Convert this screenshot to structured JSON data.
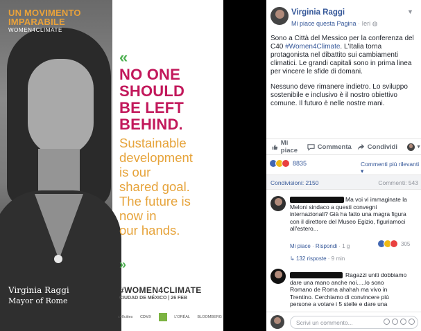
{
  "poster": {
    "brand_line1": "UN MOVIMENTO",
    "brand_line2": "IMPARABILE",
    "brand_sub": "WOMEN4CLIMATE",
    "quote_open": "«",
    "headline": [
      "NO ONE",
      "SHOULD",
      "BE LEFT",
      "BEHIND."
    ],
    "subline": [
      "Sustainable",
      "development",
      "is our",
      "shared goal.",
      "The future is",
      "now in",
      "our hands."
    ],
    "quote_close": "»",
    "speaker_name": "Virginia Raggi",
    "speaker_role": "Mayor of Rome",
    "hashtag": "#WOMEN4CLIMATE",
    "event": "CIUDAD DE MÉXICO | 26 FEB",
    "partners": [
      "c40cities",
      "CDMX",
      "",
      "L'ORÉAL",
      "BLOOMBERG"
    ]
  },
  "post": {
    "author": "Virginia Raggi",
    "like_page": "Mi piace questa Pagina",
    "time": "Ieri",
    "p1_a": "Sono a Città del Messico per la conferenza del C40 ",
    "p1_tag": "#Women4Climate",
    "p1_b": ". L'Italia torna protagonista nel dibattito sui cambiamenti climatici. Le grandi capitali sono in prima linea per vincere le sfide di domani.",
    "p2": "Nessuno deve rimanere indietro. Lo sviluppo sostenibile e inclusivo è il nostro obiettivo comune. Il futuro è nelle nostre mani."
  },
  "actions": {
    "like": "Mi piace",
    "comment": "Commenta",
    "share": "Condividi"
  },
  "reactions": {
    "count": "8835",
    "sort_label": "Commenti più rilevanti"
  },
  "counts": {
    "shares": "Condivisioni: 2150",
    "comments": "Commenti: 543"
  },
  "comments": [
    {
      "text": "Ma voi vi immaginate la Meloni sindaco a questi convegni internazionali? Già ha fatto una magra figura con il direttore del Museo Egizio, figuriamoci all'estero...",
      "like": "Mi piace",
      "reply": "Rispondi",
      "age": "1 g",
      "react_count": "305",
      "replies": "132 risposte",
      "replies_age": "9 min"
    },
    {
      "text": "Ragazzi uniti dobbiamo dare una mano anche noi.....lo sono Romano de Roma ahahah ma vivo in Trentino. Cerchiamo di convincere più persone a votare i 5 stelle e dare una"
    }
  ],
  "composer": {
    "placeholder": "Scrivi un commento..."
  },
  "colors": {
    "fb_blue": "#365899",
    "headline_magenta": "#c2185b",
    "subline_orange": "#e6a33a",
    "quote_green": "#4caf50"
  }
}
